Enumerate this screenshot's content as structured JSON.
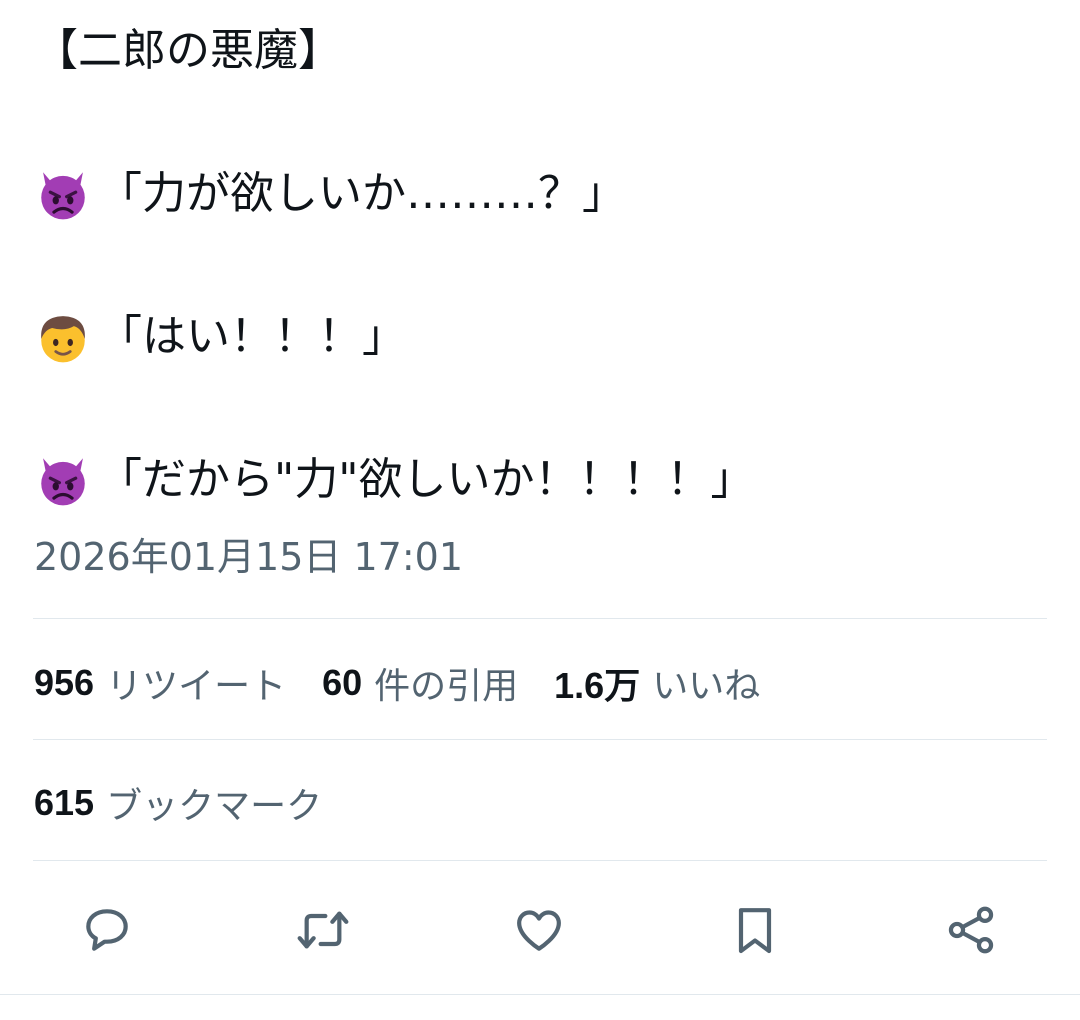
{
  "tweet": {
    "title": "【二郎の悪魔】",
    "lines": [
      {
        "speaker_icon": "angry-devil-emoji",
        "text": "「力が欲しいか………？」"
      },
      {
        "speaker_icon": "boy-emoji",
        "text": "「はい！！！」"
      },
      {
        "speaker_icon": "angry-devil-emoji",
        "text": "「だから\"力\"欲しいか！！！！」"
      }
    ],
    "timestamp": "2026年01月15日 17:01"
  },
  "stats": {
    "retweets": {
      "count": "956",
      "label": "リツイート"
    },
    "quotes": {
      "count": "60",
      "label": "件の引用"
    },
    "likes": {
      "count": "1.6万",
      "label": "いいね"
    },
    "bookmarks": {
      "count": "615",
      "label": "ブックマーク"
    }
  },
  "actions": {
    "icons": [
      "reply-icon",
      "retweet-icon",
      "like-icon",
      "bookmark-icon",
      "share-icon"
    ],
    "icon_color": "#536471"
  },
  "colors": {
    "text": "#0f1419",
    "secondary": "#536471",
    "divider": "#e1e8ed",
    "devil": "#a23db4",
    "boy_hair": "#6d4c41",
    "boy_skin": "#fbc02d"
  }
}
